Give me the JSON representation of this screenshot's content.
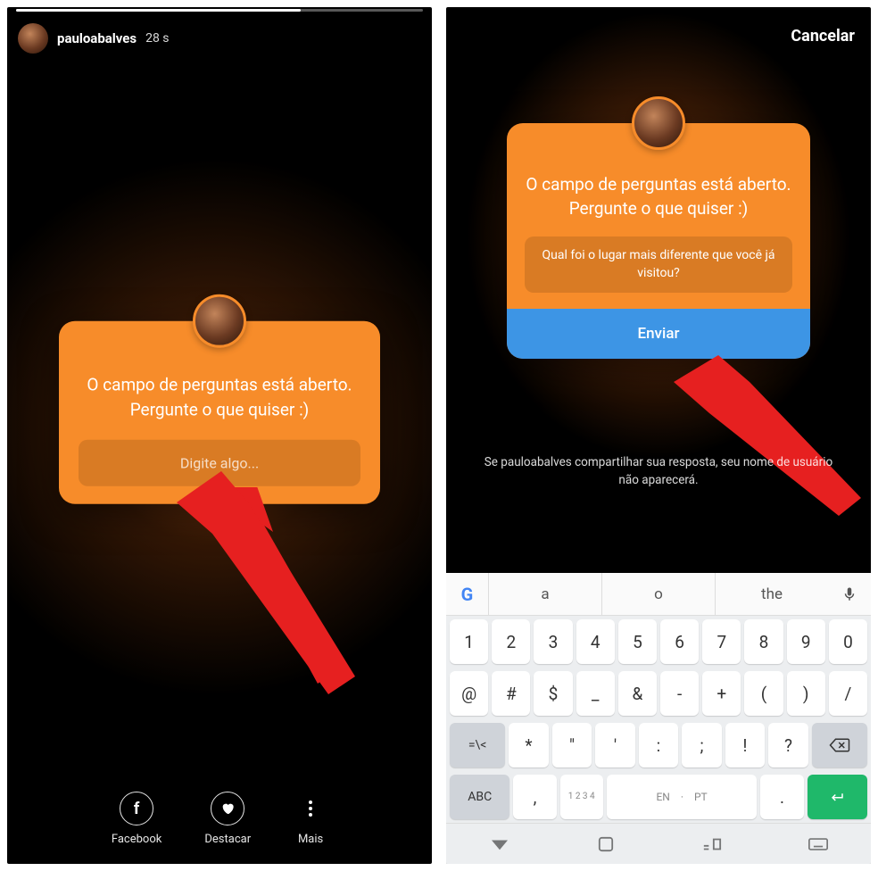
{
  "left": {
    "username": "pauloabalves",
    "time": "28 s",
    "card_prompt": "O campo de perguntas está aberto. Pergunte o que quiser :)",
    "input_placeholder": "Digite algo...",
    "footer": {
      "facebook": "Facebook",
      "destacar": "Destacar",
      "mais": "Mais"
    }
  },
  "right": {
    "cancel": "Cancelar",
    "card_prompt": "O campo de perguntas está aberto. Pergunte o que quiser :)",
    "input_value": "Qual foi o lugar mais diferente que você já visitou?",
    "send_label": "Enviar",
    "disclaimer": "Se pauloabalves compartilhar sua resposta, seu nome de usuário não aparecerá."
  },
  "keyboard": {
    "suggestions": [
      "a",
      "o",
      "the"
    ],
    "row1": [
      "1",
      "2",
      "3",
      "4",
      "5",
      "6",
      "7",
      "8",
      "9",
      "0"
    ],
    "row2": [
      "@",
      "#",
      "$",
      "_",
      "&",
      "-",
      "+",
      "(",
      ")",
      "/"
    ],
    "sym_toggle": "=\\<",
    "row3": [
      "*",
      "\"",
      "'",
      ":",
      ";",
      "!",
      "?"
    ],
    "abc": "ABC",
    "comma": ",",
    "numpad_hint": "1 2\n3 4",
    "space_lang1": "EN",
    "space_sep": "·",
    "space_lang2": "PT",
    "period": "."
  }
}
